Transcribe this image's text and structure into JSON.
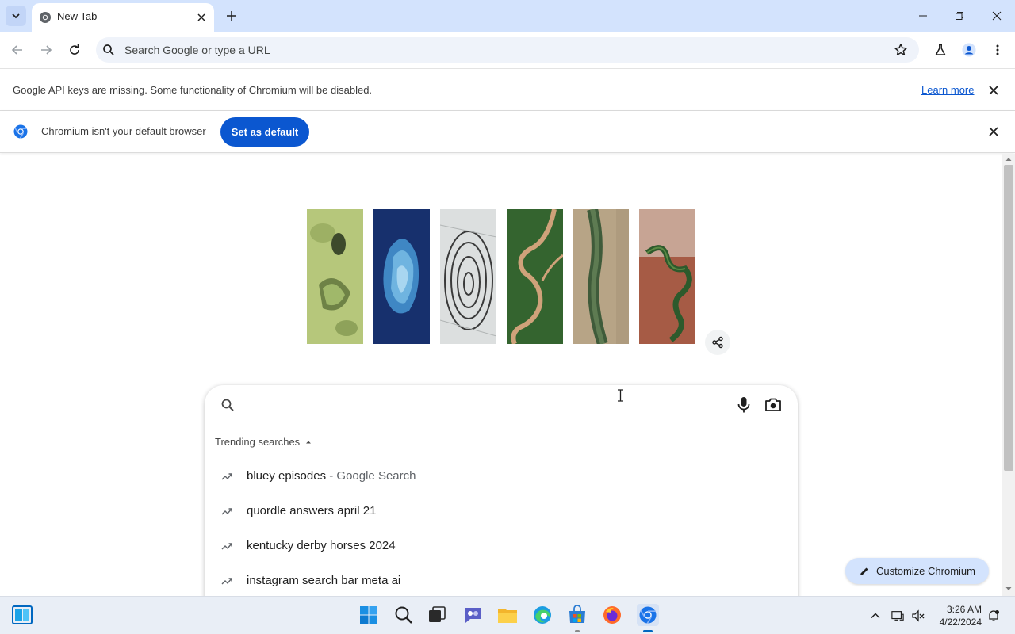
{
  "browser": {
    "tab": {
      "title": "New Tab",
      "favicon": "chromium-icon"
    },
    "window_controls": [
      "minimize",
      "restore",
      "close"
    ]
  },
  "toolbar": {
    "omnibox_placeholder": "Search Google or type a URL"
  },
  "infobars": {
    "api_keys": {
      "message": "Google API keys are missing. Some functionality of Chromium will be disabled.",
      "link": "Learn more"
    },
    "default_browser": {
      "message": "Chromium isn't your default browser",
      "button": "Set as default"
    }
  },
  "ntp": {
    "doodle": {
      "panels": [
        "green-marsh",
        "blue-island",
        "rock-rings",
        "river-meander",
        "river-valley",
        "red-delta"
      ]
    },
    "search": {
      "trending_heading": "Trending searches",
      "trending": [
        {
          "text": "bluey episodes",
          "suffix": " - Google Search"
        },
        {
          "text": "quordle answers april 21",
          "suffix": ""
        },
        {
          "text": "kentucky derby horses 2024",
          "suffix": ""
        },
        {
          "text": "instagram search bar meta ai",
          "suffix": ""
        }
      ]
    },
    "customize_label": "Customize Chromium"
  },
  "taskbar": {
    "apps": [
      "start",
      "search",
      "task-view",
      "teams",
      "file-explorer",
      "edge",
      "store",
      "firefox",
      "chromium"
    ],
    "clock": {
      "time": "3:26 AM",
      "date": "4/22/2024"
    }
  },
  "colors": {
    "tabstrip": "#d3e3fd",
    "accent": "#0b57d0",
    "omnibox": "#eff3fa"
  }
}
